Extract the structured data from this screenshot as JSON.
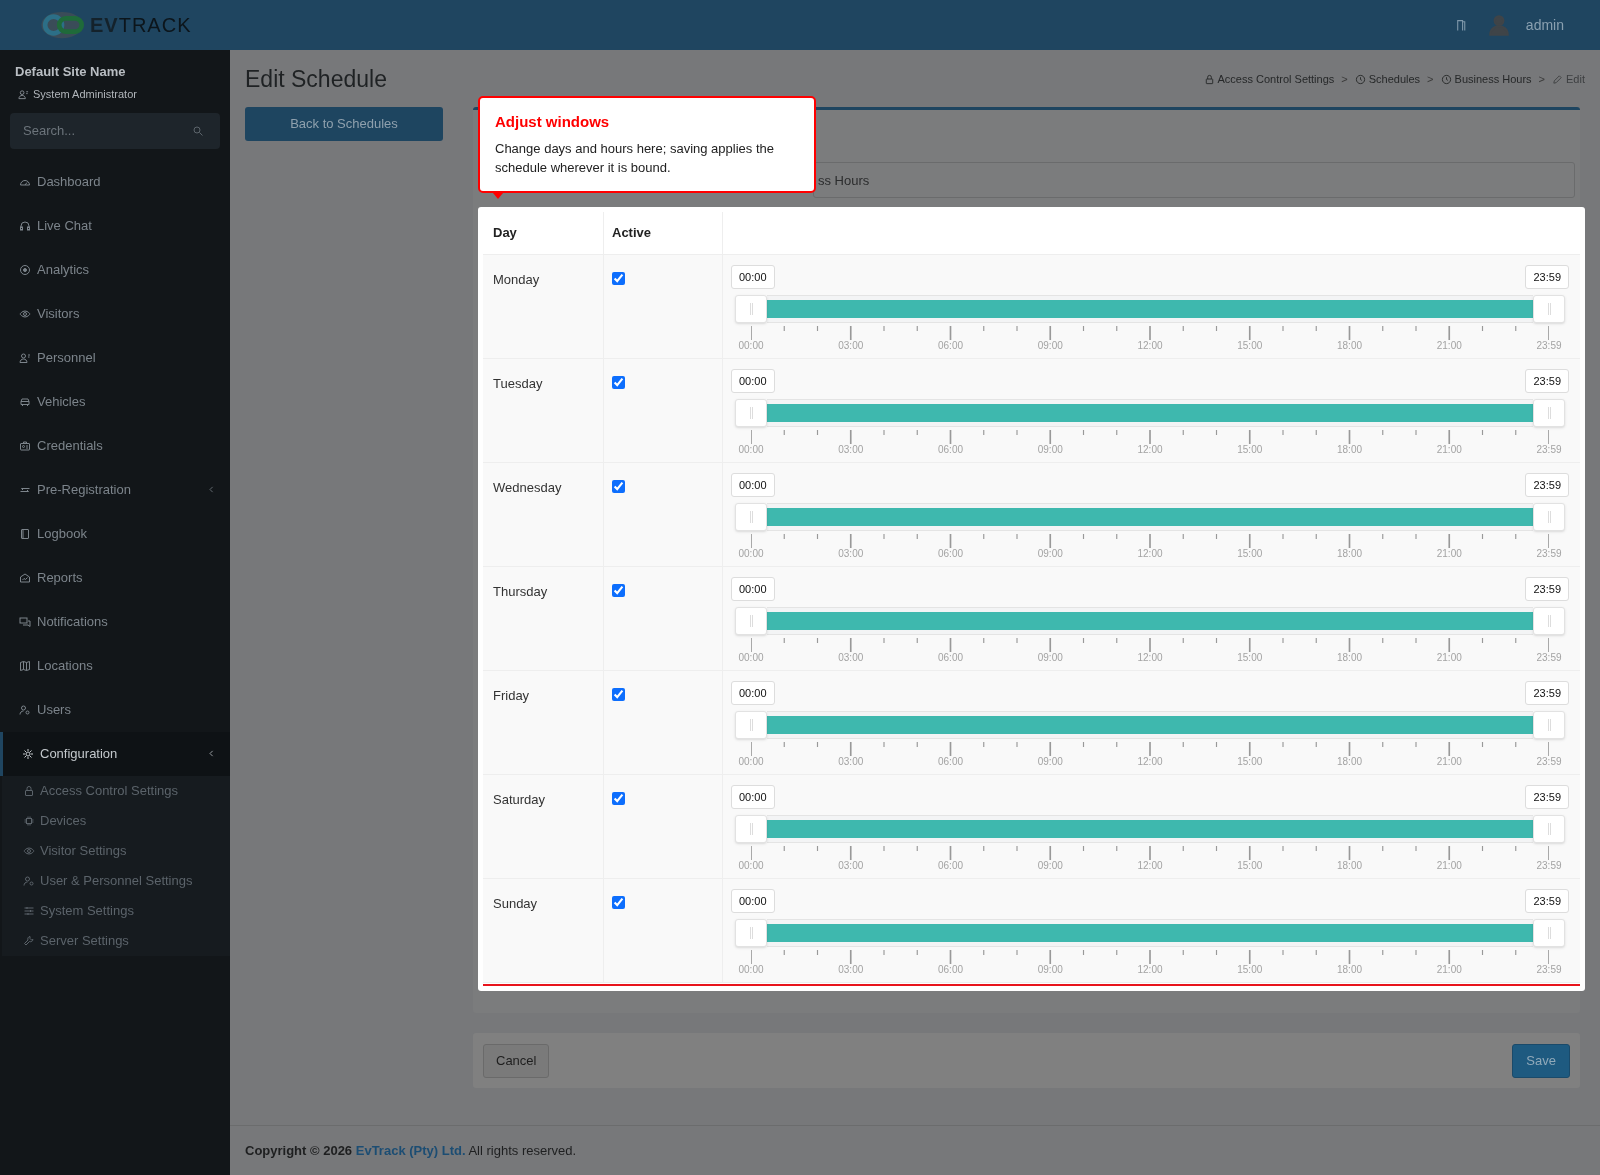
{
  "topbar": {
    "logo": {
      "bold": "EV",
      "light": "TRACK"
    },
    "user": "admin"
  },
  "sidebar": {
    "site": "Default Site Name",
    "role": "System Administrator",
    "search": {
      "placeholder": "Search..."
    },
    "items": [
      {
        "label": "Dashboard",
        "kind": "link",
        "selected": false
      },
      {
        "label": "Live Chat",
        "kind": "link",
        "selected": false
      },
      {
        "label": "Analytics",
        "kind": "link",
        "selected": false
      },
      {
        "label": "Visitors",
        "kind": "link",
        "selected": false
      },
      {
        "label": "Personnel",
        "kind": "link",
        "selected": false
      },
      {
        "label": "Vehicles",
        "kind": "link",
        "selected": false
      },
      {
        "label": "Credentials",
        "kind": "link",
        "selected": false
      },
      {
        "label": "Pre-Registration",
        "kind": "group",
        "selected": false
      },
      {
        "label": "Logbook",
        "kind": "link",
        "selected": false
      },
      {
        "label": "Reports",
        "kind": "link",
        "selected": false
      },
      {
        "label": "Notifications",
        "kind": "link",
        "selected": false
      },
      {
        "label": "Locations",
        "kind": "link",
        "selected": false
      },
      {
        "label": "Users",
        "kind": "link",
        "selected": false
      },
      {
        "label": "Configuration",
        "kind": "group",
        "selected": true,
        "children": [
          {
            "label": "Access Control Settings"
          },
          {
            "label": "Devices"
          },
          {
            "label": "Visitor Settings"
          },
          {
            "label": "User & Personnel Settings"
          },
          {
            "label": "System Settings"
          },
          {
            "label": "Server Settings"
          }
        ]
      }
    ]
  },
  "page": {
    "title": "Edit Schedule",
    "back_button": "Back to Schedules",
    "breadcrumb": {
      "separator": ">",
      "items": [
        {
          "label": "Access Control Settings",
          "kind": "lock"
        },
        {
          "label": "Schedules",
          "kind": "clock"
        },
        {
          "label": "Business Hours",
          "kind": "clock"
        },
        {
          "label": "Edit",
          "kind": "pencil"
        }
      ]
    }
  },
  "tooltip": {
    "title": "Adjust windows",
    "text": "Change days and hours here; saving applies the schedule wherever it is bound."
  },
  "name_field": {
    "value": "ss Hours"
  },
  "table": {
    "columns": [
      "Day",
      "Active"
    ],
    "rows": [
      {
        "day": "Monday",
        "active": true,
        "start": "00:00",
        "end": "23:59",
        "level": 1,
        "ticks": [
          "00:00",
          "03:00",
          "06:00",
          "09:00",
          "12:00",
          "15:00",
          "18:00",
          "21:00",
          "23:59"
        ]
      },
      {
        "day": "Tuesday",
        "active": true,
        "start": "00:00",
        "end": "23:59",
        "level": 1,
        "ticks": [
          "00:00",
          "03:00",
          "06:00",
          "09:00",
          "12:00",
          "15:00",
          "18:00",
          "21:00",
          "23:59"
        ]
      },
      {
        "day": "Wednesday",
        "active": true,
        "start": "00:00",
        "end": "23:59",
        "level": 1,
        "ticks": [
          "00:00",
          "03:00",
          "06:00",
          "09:00",
          "12:00",
          "15:00",
          "18:00",
          "21:00",
          "23:59"
        ]
      },
      {
        "day": "Thursday",
        "active": true,
        "start": "00:00",
        "end": "23:59",
        "level": 1,
        "ticks": [
          "00:00",
          "03:00",
          "06:00",
          "09:00",
          "12:00",
          "15:00",
          "18:00",
          "21:00",
          "23:59"
        ]
      },
      {
        "day": "Friday",
        "active": true,
        "start": "00:00",
        "end": "23:59",
        "level": 1,
        "ticks": [
          "00:00",
          "03:00",
          "06:00",
          "09:00",
          "12:00",
          "15:00",
          "18:00",
          "21:00",
          "23:59"
        ]
      },
      {
        "day": "Saturday",
        "active": true,
        "start": "00:00",
        "end": "23:59",
        "level": 1,
        "ticks": [
          "00:00",
          "03:00",
          "06:00",
          "09:00",
          "12:00",
          "15:00",
          "18:00",
          "21:00",
          "23:59"
        ]
      },
      {
        "day": "Sunday",
        "active": true,
        "start": "00:00",
        "end": "23:59",
        "level": 1,
        "ticks": [
          "00:00",
          "03:00",
          "06:00",
          "09:00",
          "12:00",
          "15:00",
          "18:00",
          "21:00",
          "23:59"
        ]
      }
    ]
  },
  "buttons": {
    "cancel": "Cancel",
    "save": "Save"
  },
  "footer": {
    "bold": "Copyright © 2026",
    "link": "EvTrack (Pty) Ltd.",
    "rest": "All rights reserved."
  }
}
